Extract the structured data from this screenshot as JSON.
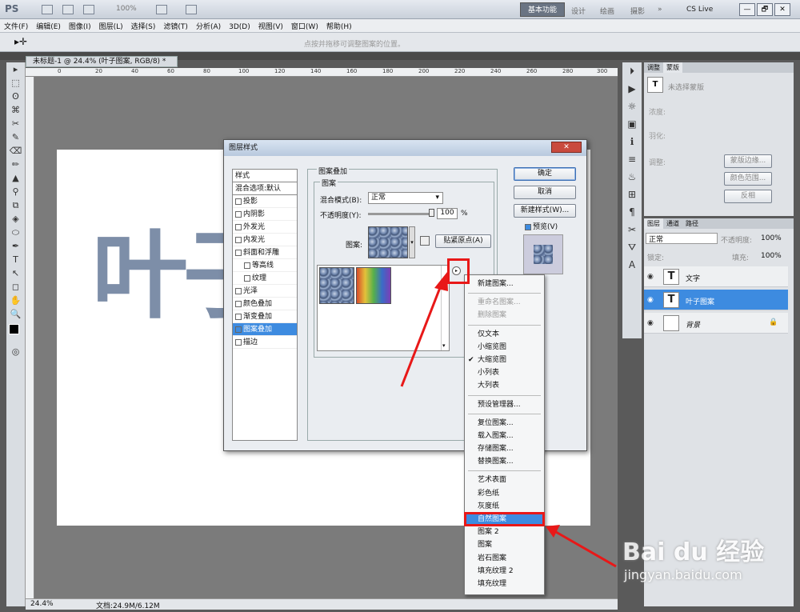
{
  "app": {
    "logo": "PS",
    "zoom": "100%"
  },
  "workspace": {
    "active": "基本功能",
    "items": [
      "设计",
      "绘画",
      "摄影",
      "»"
    ],
    "cslive": "CS Live",
    "win_buttons": [
      "—",
      "🗗",
      "✕"
    ]
  },
  "menubar": [
    "文件(F)",
    "编辑(E)",
    "图像(I)",
    "图层(L)",
    "选择(S)",
    "滤镜(T)",
    "分析(A)",
    "3D(D)",
    "视图(V)",
    "窗口(W)",
    "帮助(H)"
  ],
  "options": {
    "hint": "点按并拖移可调整图案的位置。"
  },
  "document": {
    "tab": "未标题-1 @ 24.4% (叶子图案, RGB/8) *",
    "ruler_marks": [
      "0",
      "20",
      "40",
      "60",
      "80",
      "100",
      "120",
      "140",
      "160",
      "180",
      "200",
      "220",
      "240",
      "260",
      "280",
      "300"
    ],
    "canvas_text": "叶子",
    "status_zoom": "24.4%",
    "status_doc": "文档:24.9M/6.12M"
  },
  "tools": [
    "▸",
    "⬚",
    "ʘ",
    "⌘",
    "✂",
    "✎",
    "⌫",
    "✏",
    "▲",
    "⚲",
    "⧉",
    "◈",
    "⬭",
    "✒",
    "T",
    "↖",
    "◻",
    "✋",
    "🔍"
  ],
  "adjust_panel": {
    "tabs": [
      "调整",
      "蒙版"
    ],
    "layer_mask_title": "未选择蒙版",
    "density_label": "浓度:",
    "feather_label": "羽化:",
    "refine_label": "调整:",
    "buttons": [
      "蒙版边缘...",
      "颜色范围...",
      "反相"
    ]
  },
  "layers_panel": {
    "tabs": [
      "图层",
      "通道",
      "路径"
    ],
    "blend_mode": "正常",
    "opacity_label": "不透明度:",
    "opacity": "100%",
    "lock_label": "锁定:",
    "fill_label": "填充:",
    "fill": "100%",
    "layers": [
      {
        "thumb": "T",
        "name": "文字",
        "selected": false
      },
      {
        "thumb": "T",
        "name": "叶子图案",
        "selected": true
      },
      {
        "thumb": "",
        "name": "背景",
        "selected": false
      }
    ]
  },
  "dialog": {
    "title": "图层样式",
    "close": "✕",
    "styles": [
      {
        "label": "样式",
        "checkbox": false,
        "hdr": true
      },
      {
        "label": "混合选项:默认",
        "checkbox": false,
        "hdr": true
      },
      {
        "label": "投影",
        "checkbox": true
      },
      {
        "label": "内阴影",
        "checkbox": true
      },
      {
        "label": "外发光",
        "checkbox": true
      },
      {
        "label": "内发光",
        "checkbox": true
      },
      {
        "label": "斜面和浮雕",
        "checkbox": true
      },
      {
        "label": "等高线",
        "checkbox": true,
        "indent": true
      },
      {
        "label": "纹理",
        "checkbox": true,
        "indent": true
      },
      {
        "label": "光泽",
        "checkbox": true
      },
      {
        "label": "颜色叠加",
        "checkbox": true
      },
      {
        "label": "渐变叠加",
        "checkbox": true
      },
      {
        "label": "图案叠加",
        "checkbox": true,
        "checked": true,
        "selected": true
      },
      {
        "label": "描边",
        "checkbox": true
      }
    ],
    "section_title": "图案叠加",
    "subsection_title": "图案",
    "blend_label": "混合模式(B):",
    "blend_value": "正常",
    "opacity_label": "不透明度(Y):",
    "opacity_value": "100",
    "opacity_unit": "%",
    "pattern_label": "图案:",
    "snap_button": "贴紧原点(A)",
    "ok": "确定",
    "cancel": "取消",
    "new_style": "新建样式(W)...",
    "preview": "预览(V)"
  },
  "pattern_menu": {
    "groups": [
      [
        {
          "label": "新建图案..."
        }
      ],
      [
        {
          "label": "重命名图案...",
          "disabled": true
        },
        {
          "label": "删除图案",
          "disabled": true
        }
      ],
      [
        {
          "label": "仅文本"
        },
        {
          "label": "小缩览图"
        },
        {
          "label": "大缩览图",
          "checked": true
        },
        {
          "label": "小列表"
        },
        {
          "label": "大列表"
        }
      ],
      [
        {
          "label": "预设管理器..."
        }
      ],
      [
        {
          "label": "复位图案..."
        },
        {
          "label": "载入图案..."
        },
        {
          "label": "存储图案..."
        },
        {
          "label": "替换图案..."
        }
      ],
      [
        {
          "label": "艺术表面"
        },
        {
          "label": "彩色纸"
        },
        {
          "label": "灰度纸"
        },
        {
          "label": "自然图案",
          "highlight": true
        },
        {
          "label": "图案 2"
        },
        {
          "label": "图案"
        },
        {
          "label": "岩石图案"
        },
        {
          "label": "填充纹理 2"
        },
        {
          "label": "填充纹理"
        }
      ]
    ]
  },
  "watermark": {
    "brand": "Bai du 经验",
    "url": "jingyan.baidu.com"
  },
  "colors": {
    "highlight": "#3d8be0",
    "annotation_red": "#e81818"
  }
}
